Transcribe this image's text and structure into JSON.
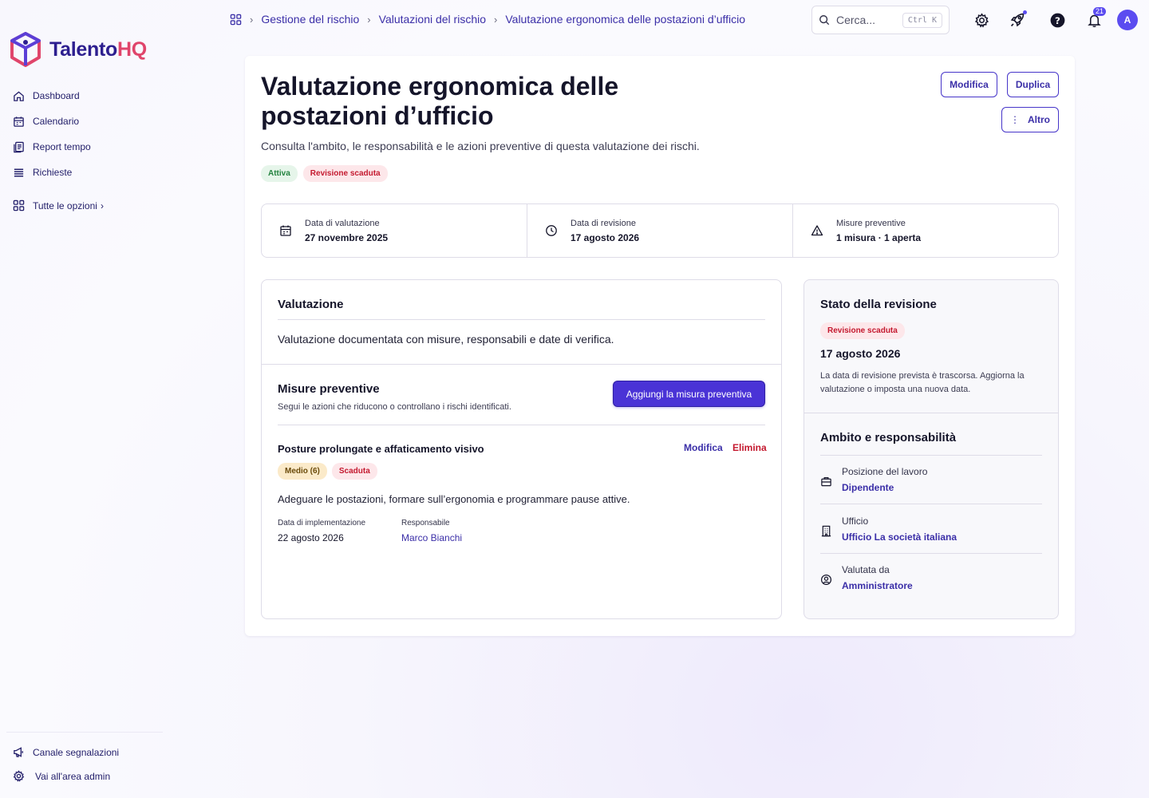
{
  "brand": {
    "name_main": "Talento",
    "name_accent": "HQ"
  },
  "sidebar": {
    "items": [
      {
        "label": "Dashboard",
        "icon": "home-icon"
      },
      {
        "label": "Calendario",
        "icon": "calendar-icon"
      },
      {
        "label": "Report tempo",
        "icon": "report-icon"
      },
      {
        "label": "Richieste",
        "icon": "list-icon"
      }
    ],
    "all_options": "Tutte le opzioni",
    "bottom": [
      {
        "label": "Canale segnalazioni",
        "icon": "megaphone-icon"
      },
      {
        "label": "Vai all'area admin",
        "icon": "gear-icon"
      }
    ]
  },
  "breadcrumb": [
    "Gestione del rischio",
    "Valutazioni del rischio",
    "Valutazione ergonomica delle postazioni d’ufficio"
  ],
  "search": {
    "placeholder": "Cerca...",
    "shortcut": "Ctrl K"
  },
  "header_icons": [
    "gear-icon",
    "rocket-icon",
    "help-icon",
    "bell-icon"
  ],
  "notifications_count": "21",
  "user": {
    "initial": "A"
  },
  "page": {
    "title": "Valutazione ergonomica delle postazioni d’ufficio",
    "subtitle": "Consulta l'ambito, le responsabilità e le azioni preventive di questa valutazione dei rischi.",
    "badges": [
      "Attiva",
      "Revisione scaduta"
    ],
    "actions": {
      "edit": "Modifica",
      "duplicate": "Duplica",
      "more": "Altro"
    }
  },
  "stats": [
    {
      "label": "Data di valutazione",
      "value": "27 novembre 2025",
      "icon": "calendar-icon"
    },
    {
      "label": "Data di revisione",
      "value": "17 agosto 2026",
      "icon": "clock-icon"
    },
    {
      "label": "Misure preventive",
      "value": "1 misura · 1 aperta",
      "icon": "warning-icon"
    }
  ],
  "assessment": {
    "title": "Valutazione",
    "description": "Valutazione documentata con misure, responsabili e date di verifica."
  },
  "measures": {
    "title": "Misure preventive",
    "subtitle": "Segui le azioni che riducono o controllano i rischi identificati.",
    "add_button": "Aggiungi la misura preventiva",
    "items": [
      {
        "title": "Posture prolungate e affaticamento visivo",
        "edit": "Modifica",
        "delete": "Elimina",
        "badges": [
          "Medio (6)",
          "Scaduta"
        ],
        "description": "Adeguare le postazioni, formare sull’ergonomia e programmare pause attive.",
        "impl_label": "Data di implementazione",
        "impl_value": "22 agosto 2026",
        "owner_label": "Responsabile",
        "owner_value": "Marco Bianchi"
      }
    ]
  },
  "review": {
    "title": "Stato della revisione",
    "badge": "Revisione scaduta",
    "date": "17 agosto 2026",
    "note": "La data di revisione prevista è trascorsa. Aggiorna la valutazione o imposta una nuova data."
  },
  "scope": {
    "title": "Ambito e responsabilità",
    "rows": [
      {
        "label": "Posizione del lavoro",
        "value": "Dipendente",
        "icon": "briefcase-icon"
      },
      {
        "label": "Ufficio",
        "value": "Ufficio La società italiana",
        "icon": "building-icon"
      },
      {
        "label": "Valutata da",
        "value": "Amministratore",
        "icon": "user-circle-icon"
      }
    ]
  },
  "colors": {
    "primary": "#4a33d6",
    "brand_dark": "#2d1f8f",
    "brand_accent": "#e0456b",
    "danger": "#c4192f",
    "success": "#23823f"
  }
}
